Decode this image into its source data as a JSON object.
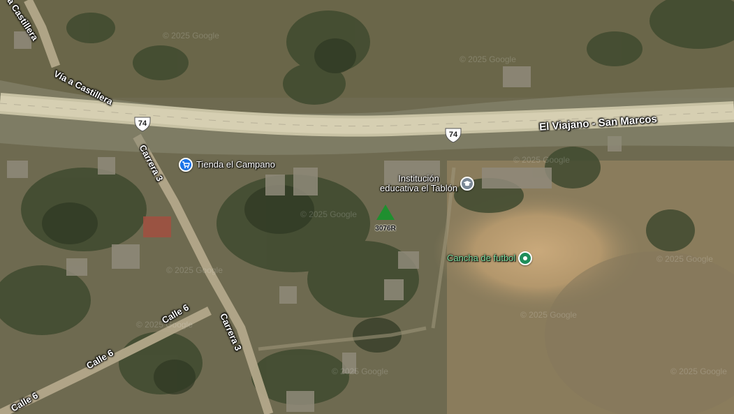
{
  "map": {
    "roads": {
      "via_castillera_top": "a Castillera",
      "via_castillera": "Vía a Castillera",
      "highway": "El Viajano - San Marcos",
      "carrera3_upper": "Carrera 3",
      "carrera3_lower": "Carrera 3",
      "calle6_upper": "Calle 6",
      "calle6_mid": "Calle 6",
      "calle6_lower": "Calle 6"
    },
    "route_shields": {
      "left": "74",
      "right": "74"
    },
    "pois": {
      "store": {
        "label": "Tienda el Campano",
        "icon": "shopping-cart-icon",
        "color": "#1a73e8"
      },
      "school": {
        "label_line1": "Institución",
        "label_line2": "educativa el Tablón",
        "icon": "graduation-cap-icon",
        "color": "#7a8896"
      },
      "field": {
        "label": "Cancha de futbol",
        "icon": "park-pin-icon",
        "color": "#1e8e5a"
      }
    },
    "peak": {
      "label": "3076R",
      "icon": "peak-triangle-icon",
      "color": "#1f8f2f"
    },
    "watermark": "© 2025 Google"
  }
}
